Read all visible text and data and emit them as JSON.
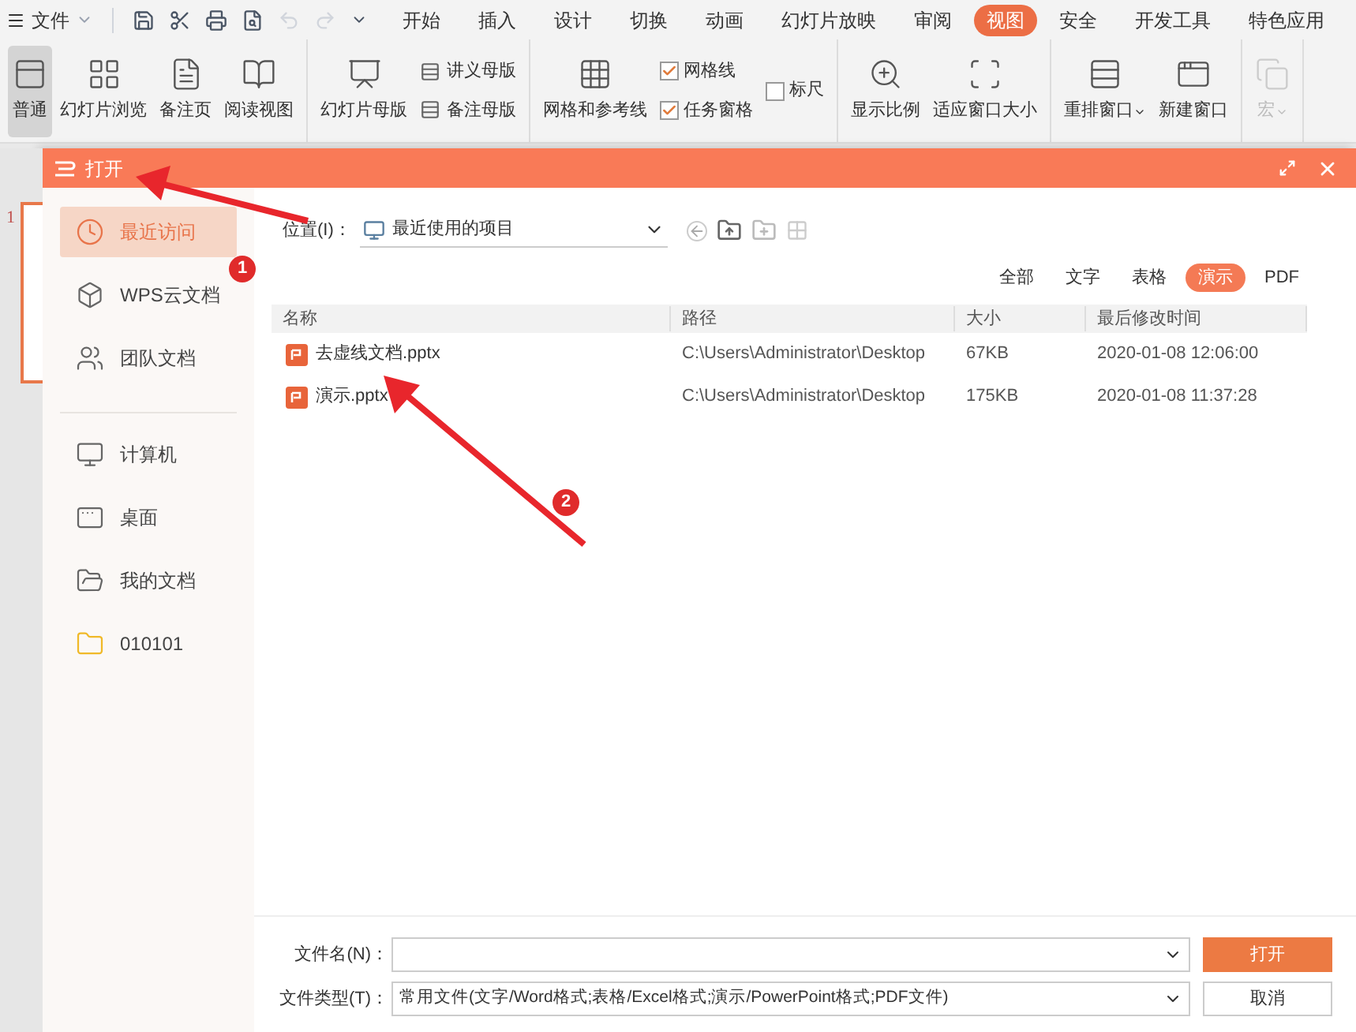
{
  "menu": {
    "app_menu": "文件",
    "tabs": [
      {
        "label": "开始",
        "selected": false
      },
      {
        "label": "插入",
        "selected": false
      },
      {
        "label": "设计",
        "selected": false
      },
      {
        "label": "切换",
        "selected": false
      },
      {
        "label": "动画",
        "selected": false
      },
      {
        "label": "幻灯片放映",
        "selected": false
      },
      {
        "label": "审阅",
        "selected": false
      },
      {
        "label": "视图",
        "selected": true
      },
      {
        "label": "安全",
        "selected": false
      },
      {
        "label": "开发工具",
        "selected": false
      },
      {
        "label": "特色应用",
        "selected": false
      }
    ]
  },
  "ribbon": [
    {
      "items": [
        {
          "kind": "large",
          "label": "普通",
          "selected": true,
          "dropdown": false,
          "disabled": false
        },
        {
          "kind": "large",
          "label": "幻灯片浏览",
          "selected": false,
          "dropdown": false,
          "disabled": false
        },
        {
          "kind": "large",
          "label": "备注页",
          "selected": false,
          "dropdown": false,
          "disabled": false
        },
        {
          "kind": "large",
          "label": "阅读视图",
          "selected": false,
          "dropdown": false,
          "disabled": false
        }
      ]
    },
    {
      "items": [
        {
          "kind": "large",
          "label": "幻灯片母版",
          "selected": false,
          "dropdown": false,
          "disabled": false
        },
        {
          "kind": "stack",
          "entries": [
            {
              "kind": "small",
              "label": "讲义母版"
            },
            {
              "kind": "small",
              "label": "备注母版"
            }
          ]
        }
      ]
    },
    {
      "items": [
        {
          "kind": "large",
          "label": "网格和参考线",
          "selected": false,
          "dropdown": false,
          "disabled": false
        },
        {
          "kind": "stack",
          "entries": [
            {
              "kind": "check",
              "label": "网格线",
              "checked": true
            },
            {
              "kind": "check",
              "label": "任务窗格",
              "checked": true
            }
          ]
        },
        {
          "kind": "stack",
          "entries": [
            {
              "kind": "check",
              "label": "标尺",
              "checked": false
            }
          ]
        }
      ]
    },
    {
      "items": [
        {
          "kind": "large",
          "label": "显示比例",
          "selected": false,
          "dropdown": false,
          "disabled": false
        },
        {
          "kind": "large",
          "label": "适应窗口大小",
          "selected": false,
          "dropdown": false,
          "disabled": false
        }
      ]
    },
    {
      "items": [
        {
          "kind": "large",
          "label": "重排窗口",
          "selected": false,
          "dropdown": true,
          "disabled": false
        },
        {
          "kind": "large",
          "label": "新建窗口",
          "selected": false,
          "dropdown": false,
          "disabled": false
        }
      ]
    },
    {
      "items": [
        {
          "kind": "large",
          "label": "宏",
          "selected": false,
          "dropdown": true,
          "disabled": true
        }
      ]
    }
  ],
  "slide_panel": {
    "slide_number": "1"
  },
  "dialog": {
    "title": "打开",
    "sidebar": {
      "groups": [
        [
          {
            "label": "最近访问",
            "selected": true
          },
          {
            "label": "WPS云文档",
            "selected": false
          },
          {
            "label": "团队文档",
            "selected": false
          }
        ],
        [
          {
            "label": "计算机",
            "selected": false
          },
          {
            "label": "桌面",
            "selected": false
          },
          {
            "label": "我的文档",
            "selected": false
          },
          {
            "label": "010101",
            "selected": false
          }
        ]
      ]
    },
    "location": {
      "label": "位置(I)：",
      "value": "最近使用的项目"
    },
    "filters": [
      {
        "label": "全部",
        "selected": false
      },
      {
        "label": "文字",
        "selected": false
      },
      {
        "label": "表格",
        "selected": false
      },
      {
        "label": "演示",
        "selected": true
      },
      {
        "label": "PDF",
        "selected": false
      }
    ],
    "table": {
      "columns": [
        "名称",
        "路径",
        "大小",
        "最后修改时间"
      ],
      "rows": [
        {
          "name": "去虚线文档.pptx",
          "path": "C:\\Users\\Administrator\\Desktop",
          "size": "67KB",
          "modified": "2020-01-08 12:06:00"
        },
        {
          "name": "演示.pptx",
          "path": "C:\\Users\\Administrator\\Desktop",
          "size": "175KB",
          "modified": "2020-01-08 11:37:28"
        }
      ]
    },
    "file_name": {
      "label": "文件名(N)："
    },
    "file_type": {
      "label": "文件类型(T)：",
      "value": "常用文件(文字/Word格式;表格/Excel格式;演示/PowerPoint格式;PDF文件)"
    },
    "buttons": [
      {
        "kind": "primary",
        "label": "打开"
      },
      {
        "kind": "secondary",
        "label": "取消"
      }
    ]
  },
  "annotations": [
    {
      "label": "1"
    },
    {
      "label": "2"
    }
  ]
}
